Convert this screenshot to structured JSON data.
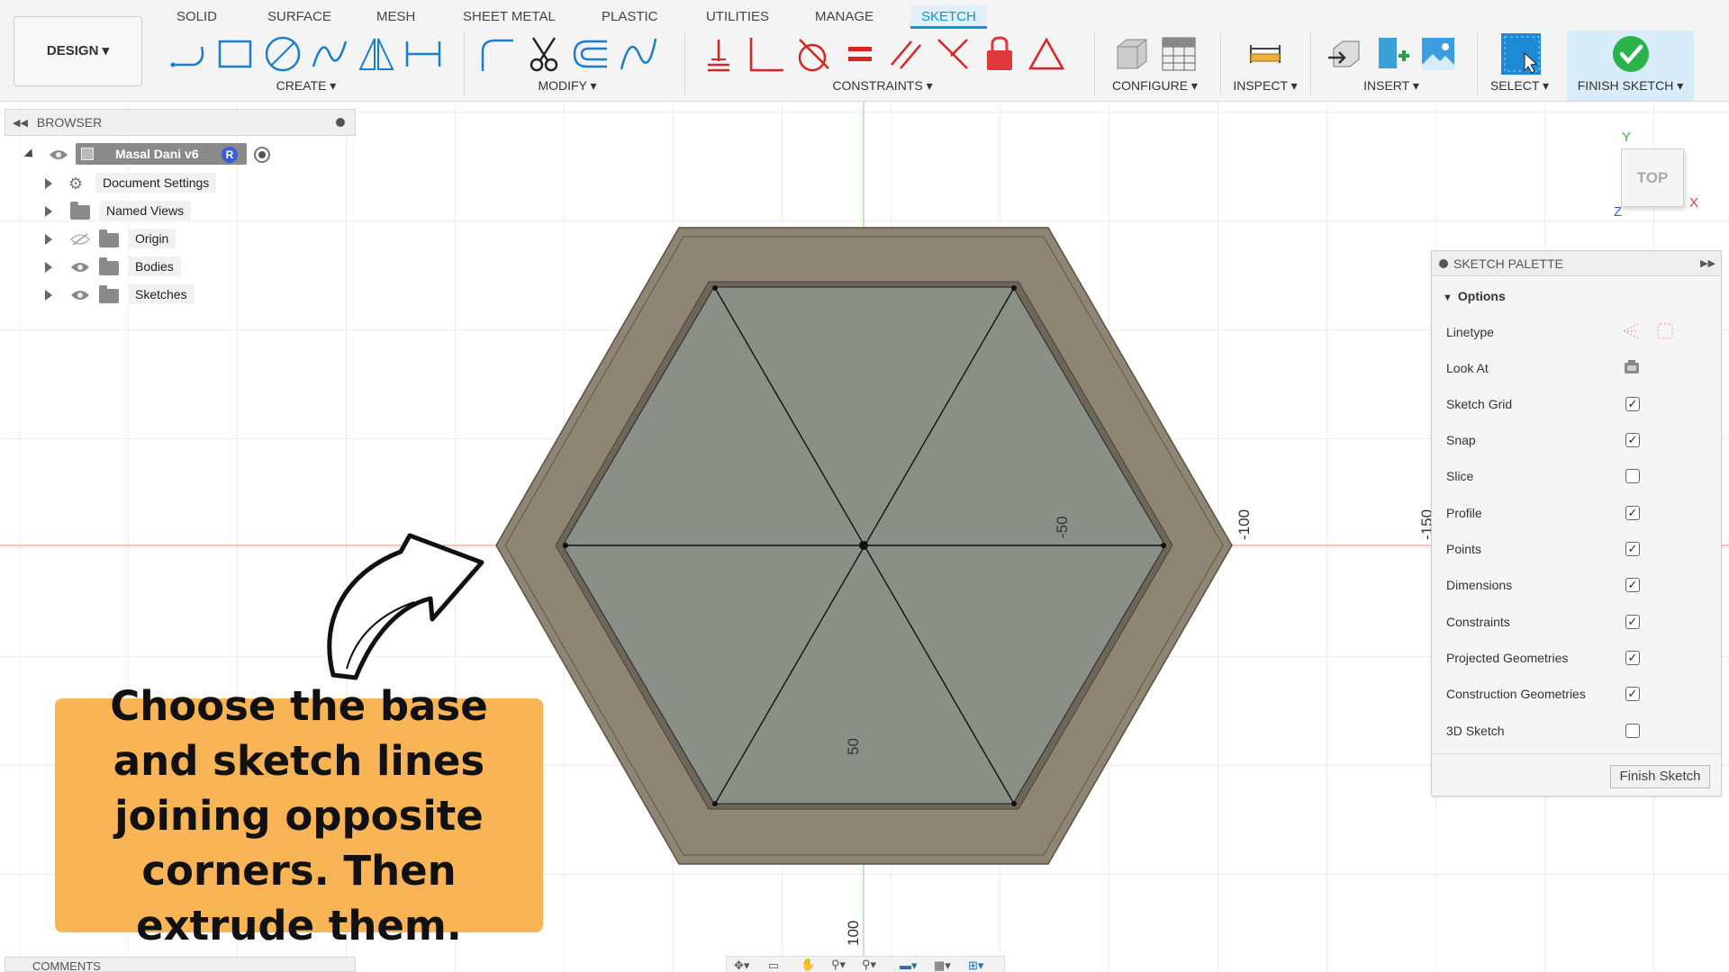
{
  "toolbar": {
    "design_label": "DESIGN ▾",
    "tabs": [
      {
        "label": "SOLID"
      },
      {
        "label": "SURFACE"
      },
      {
        "label": "MESH"
      },
      {
        "label": "SHEET METAL"
      },
      {
        "label": "PLASTIC"
      },
      {
        "label": "UTILITIES"
      },
      {
        "label": "MANAGE"
      },
      {
        "label": "SKETCH",
        "active": true
      }
    ],
    "groups": {
      "create": "CREATE ▾",
      "modify": "MODIFY ▾",
      "constraints": "CONSTRAINTS ▾",
      "configure": "CONFIGURE ▾",
      "inspect": "INSPECT ▾",
      "insert": "INSERT ▾",
      "select": "SELECT ▾",
      "finish_sketch": "FINISH SKETCH ▾"
    },
    "accent_color": "#0696d7"
  },
  "browser": {
    "title": "BROWSER",
    "root": {
      "label": "Masal Dani v6",
      "badge": "R"
    },
    "items": [
      {
        "label": "Document Settings",
        "icon": "gear-icon"
      },
      {
        "label": "Named Views",
        "icon": "folder-icon"
      },
      {
        "label": "Origin",
        "icon": "folder-icon",
        "visibility": "hidden"
      },
      {
        "label": "Bodies",
        "icon": "folder-icon",
        "visibility": "visible"
      },
      {
        "label": "Sketches",
        "icon": "folder-icon",
        "visibility": "visible"
      }
    ]
  },
  "viewcube": {
    "face": "TOP",
    "axis_y": "Y",
    "axis_x": "X",
    "axis_z": "Z"
  },
  "sketch_palette": {
    "title": "SKETCH PALETTE",
    "section": "Options",
    "rows": [
      {
        "label": "Linetype",
        "control": "icons"
      },
      {
        "label": "Look At",
        "control": "icon"
      },
      {
        "label": "Sketch Grid",
        "checked": true
      },
      {
        "label": "Snap",
        "checked": true
      },
      {
        "label": "Slice",
        "checked": false
      },
      {
        "label": "Profile",
        "checked": true
      },
      {
        "label": "Points",
        "checked": true
      },
      {
        "label": "Dimensions",
        "checked": true
      },
      {
        "label": "Constraints",
        "checked": true
      },
      {
        "label": "Projected Geometries",
        "checked": true
      },
      {
        "label": "Construction Geometries",
        "checked": true
      },
      {
        "label": "3D Sketch",
        "checked": false
      }
    ],
    "finish_button": "Finish Sketch"
  },
  "canvas": {
    "ruler_labels": {
      "a": "-50",
      "b": "-100",
      "c": "-150",
      "d": "50",
      "e": "100"
    }
  },
  "callout": {
    "text": "Choose the base and sketch lines joining opposite corners. Then extrude them.",
    "background": "#f9b455"
  },
  "comments": {
    "title": "COMMENTS"
  }
}
